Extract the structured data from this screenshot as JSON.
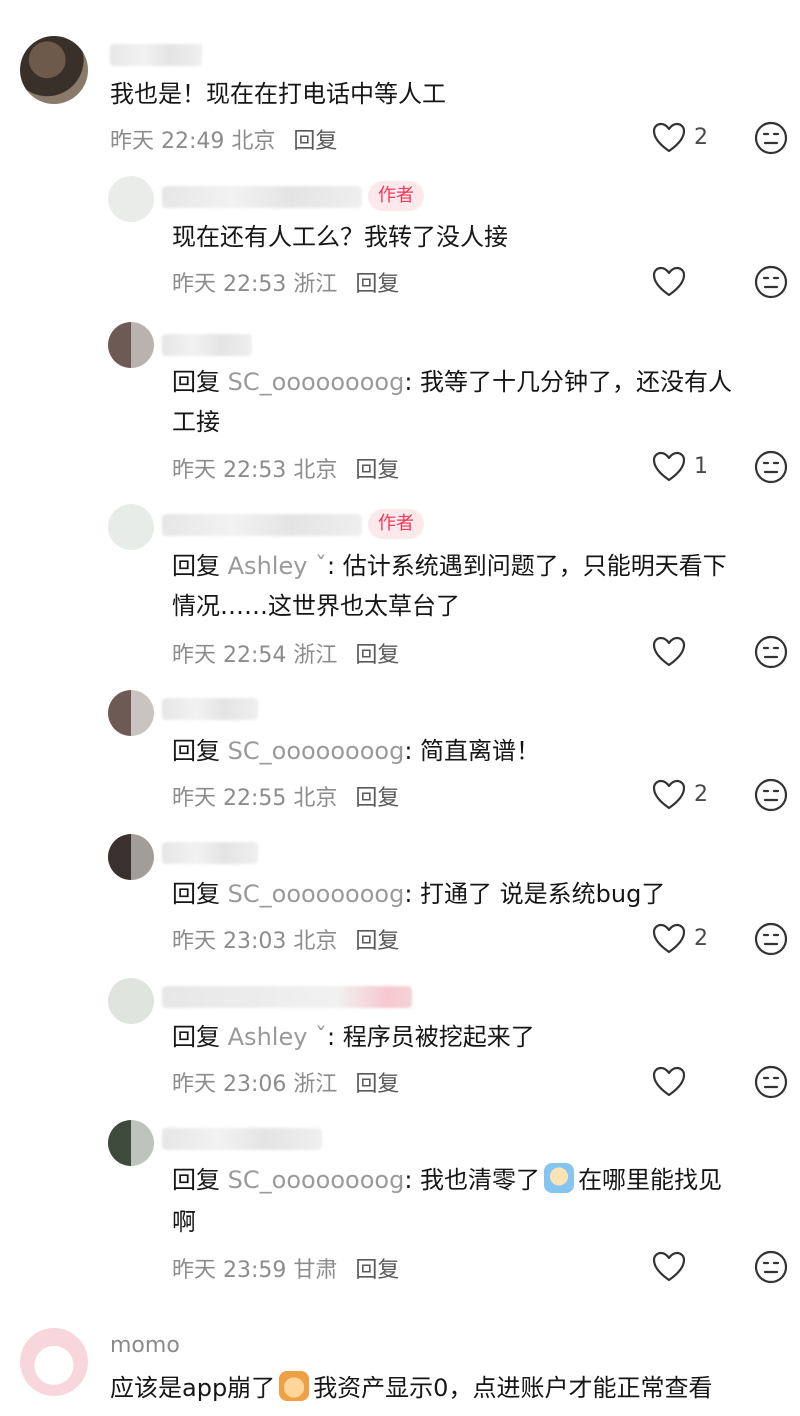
{
  "comments": [
    {
      "text": "我也是！现在在打电话中等人工",
      "time": "昨天 22:49 北京",
      "reply_label": "回复",
      "likes": "2"
    },
    {
      "badge": "作者",
      "text": "现在还有人工么？我转了没人接",
      "time": "昨天 22:53 浙江",
      "reply_label": "回复",
      "likes": ""
    },
    {
      "prefix": "回复",
      "target": "SC_oooooooog",
      "text": ": 我等了十几分钟了，还没有人",
      "text2": "工接",
      "time": "昨天 22:53 北京",
      "reply_label": "回复",
      "likes": "1"
    },
    {
      "badge": "作者",
      "prefix": "回复",
      "target": "Ashley ˇ",
      "text": ": 估计系统遇到问题了，只能明天看下",
      "text2": "情况……这世界也太草台了",
      "time": "昨天 22:54 浙江",
      "reply_label": "回复",
      "likes": ""
    },
    {
      "prefix": "回复",
      "target": "SC_oooooooog",
      "text": ": 简直离谱！",
      "time": "昨天 22:55 北京",
      "reply_label": "回复",
      "likes": "2"
    },
    {
      "prefix": "回复",
      "target": "SC_oooooooog",
      "text": ": 打通了 说是系统bug了",
      "time": "昨天 23:03 北京",
      "reply_label": "回复",
      "likes": "2"
    },
    {
      "prefix": "回复",
      "target": "Ashley ˇ",
      "text": ": 程序员被挖起来了",
      "time": "昨天 23:06 浙江",
      "reply_label": "回复",
      "likes": ""
    },
    {
      "prefix": "回复",
      "target": "SC_oooooooog",
      "text": ": 我也清零了",
      "text_after_emoji": "在哪里能找见",
      "text2": "啊",
      "time": "昨天 23:59 甘肃",
      "reply_label": "回复",
      "likes": ""
    },
    {
      "username": "momo",
      "text": "应该是app崩了",
      "text_after_emoji": "我资产显示0，点进账户才能正常查看"
    }
  ],
  "icons": {
    "like": "heart-outline-icon",
    "dislike": "neutral-face-icon",
    "emoji": "crying-emoji-icon"
  },
  "colors": {
    "badge_bg": "#fde8ec",
    "badge_text": "#f03a5a",
    "meta": "#8c8c8c",
    "reply_target": "#9a9a9a"
  }
}
